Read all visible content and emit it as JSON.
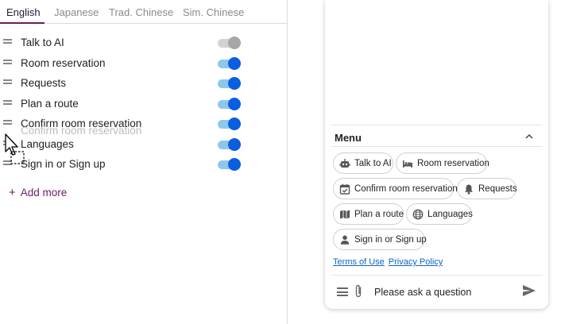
{
  "language_tabs": [
    {
      "label": "English",
      "active": true
    },
    {
      "label": "Japanese",
      "active": false
    },
    {
      "label": "Trad. Chinese",
      "active": false
    },
    {
      "label": "Sim. Chinese",
      "active": false
    }
  ],
  "menu_items": [
    {
      "label": "Talk to AI",
      "enabled": false
    },
    {
      "label": "Room reservation",
      "enabled": true
    },
    {
      "label": "Requests",
      "enabled": true
    },
    {
      "label": "Plan a route",
      "enabled": true
    },
    {
      "label": "Confirm room reservation",
      "enabled": true
    },
    {
      "label": "Languages",
      "enabled": true
    },
    {
      "label": "Sign in or Sign up",
      "enabled": true
    }
  ],
  "drag_ghost_label": "Confirm room reservation",
  "add_more": {
    "plus": "+",
    "label": "Add more"
  },
  "widget": {
    "menu_title": "Menu",
    "chips": [
      {
        "label": "Talk to AI",
        "icon": "robot-icon"
      },
      {
        "label": "Room reservation",
        "icon": "bed-icon"
      },
      {
        "label": "Confirm room reservation",
        "icon": "calendar-check-icon"
      },
      {
        "label": "Requests",
        "icon": "bell-icon"
      },
      {
        "label": "Plan a route",
        "icon": "map-icon"
      },
      {
        "label": "Languages",
        "icon": "globe-icon"
      },
      {
        "label": "Sign in or Sign up",
        "icon": "person-icon"
      }
    ],
    "links": {
      "terms": "Terms of Use",
      "privacy": "Privacy Policy"
    },
    "input_placeholder": "Please ask a question"
  },
  "colors": {
    "accent": "#6b1d62",
    "toggle_on_knob": "#0a5ee0",
    "toggle_on_track": "#8ec7ee",
    "toggle_off_knob": "#a7a7a7",
    "link": "#0b66c2"
  }
}
